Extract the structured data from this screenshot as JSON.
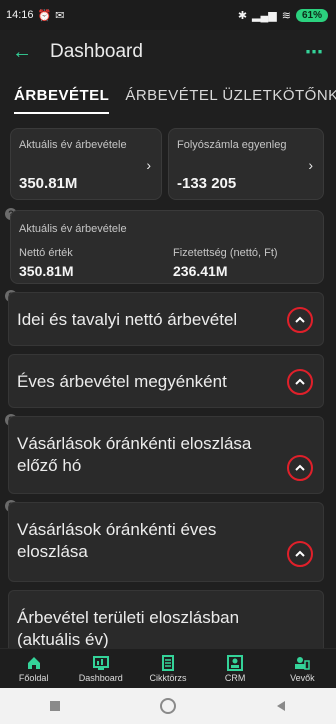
{
  "status": {
    "time": "14:16",
    "battery": "61"
  },
  "appbar": {
    "title": "Dashboard"
  },
  "tabs": [
    {
      "label": "ÁRBEVÉTEL"
    },
    {
      "label": "ÁRBEVÉTEL ÜZLETKÖTŐNKÉNT"
    }
  ],
  "cards": {
    "current_revenue": {
      "label": "Aktuális év árbevétele",
      "value": "350.81M"
    },
    "account_balance": {
      "label": "Folyószámla egyenleg",
      "value": "-133 205"
    }
  },
  "summary": {
    "title": "Aktuális év árbevétele",
    "net_label": "Nettó érték",
    "net_value": "350.81M",
    "paid_label": "Fizetettség (nettó, Ft)",
    "paid_value": "236.41M"
  },
  "sections": [
    {
      "title": "Idei és tavalyi nettó árbevétel"
    },
    {
      "title": "Éves árbevétel megyénként"
    },
    {
      "title": "Vásárlások óránkénti eloszlása előző hó"
    },
    {
      "title": "Vásárlások óránkénti éves eloszlása"
    },
    {
      "title": "Árbevétel területi eloszlásban (aktuális év)"
    }
  ],
  "bottom_nav": [
    {
      "label": "Főoldal",
      "icon": "home-icon"
    },
    {
      "label": "Dashboard",
      "icon": "dashboard-icon"
    },
    {
      "label": "Cikktörzs",
      "icon": "catalog-icon"
    },
    {
      "label": "CRM",
      "icon": "crm-icon"
    },
    {
      "label": "Vevők",
      "icon": "customers-icon"
    }
  ],
  "colors": {
    "accent": "#34d399",
    "highlight": "#e0202a",
    "background": "#1f1f1f"
  }
}
